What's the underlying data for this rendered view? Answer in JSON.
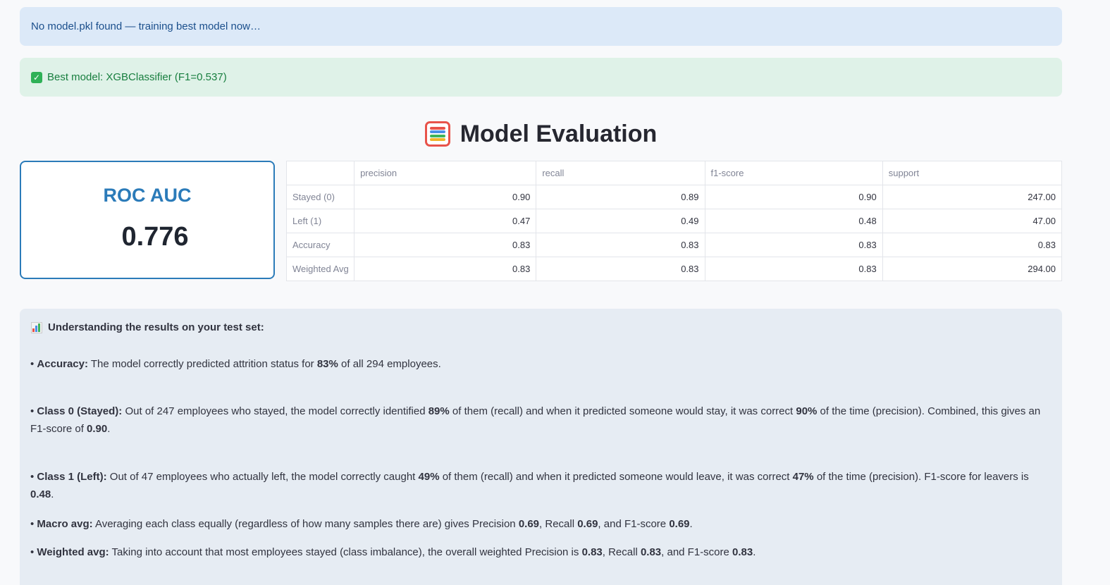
{
  "alerts": {
    "info": "No model.pkl found — training best model now…",
    "success": "Best model: XGBClassifier (F1=0.537)"
  },
  "title": "Model Evaluation",
  "roc": {
    "label": "ROC AUC",
    "value": "0.776"
  },
  "table": {
    "headers": [
      "",
      "precision",
      "recall",
      "f1-score",
      "support"
    ],
    "rows": [
      {
        "label": "Stayed (0)",
        "values": [
          "0.90",
          "0.89",
          "0.90",
          "247.00"
        ]
      },
      {
        "label": "Left (1)",
        "values": [
          "0.47",
          "0.49",
          "0.48",
          "47.00"
        ]
      },
      {
        "label": "Accuracy",
        "values": [
          "0.83",
          "0.83",
          "0.83",
          "0.83"
        ]
      },
      {
        "label": "Weighted Avg",
        "values": [
          "0.83",
          "0.83",
          "0.83",
          "294.00"
        ]
      }
    ]
  },
  "explanation": {
    "heading": "Understanding the results on your test set:",
    "accuracy": {
      "label": "Accuracy:",
      "t1": " The model correctly predicted attrition status for ",
      "b1": "83%",
      "t2": " of all 294 employees."
    },
    "class0": {
      "label": "Class 0 (Stayed):",
      "t1": " Out of 247 employees who stayed, the model correctly identified ",
      "b1": "89%",
      "t2": " of them (recall) and when it predicted someone would stay, it was correct ",
      "b2": "90%",
      "t3": " of the time (precision). Combined, this gives an F1-score of ",
      "b3": "0.90",
      "t4": "."
    },
    "class1": {
      "label": "Class 1 (Left):",
      "t1": " Out of 47 employees who actually left, the model correctly caught ",
      "b1": "49%",
      "t2": " of them (recall) and when it predicted someone would leave, it was correct ",
      "b2": "47%",
      "t3": " of the time (precision). F1-score for leavers is ",
      "b3": "0.48",
      "t4": "."
    },
    "macro": {
      "label": "Macro avg:",
      "t1": " Averaging each class equally (regardless of how many samples there are) gives Precision ",
      "b1": "0.69",
      "t2": ", Recall ",
      "b2": "0.69",
      "t3": ", and F1-score ",
      "b3": "0.69",
      "t4": "."
    },
    "weighted": {
      "label": "Weighted avg:",
      "t1": " Taking into account that most employees stayed (class imbalance), the overall weighted Precision is ",
      "b1": "0.83",
      "t2": ", Recall ",
      "b2": "0.83",
      "t3": ", and F1-score ",
      "b3": "0.83",
      "t4": "."
    }
  },
  "icons": [
    "check-icon",
    "abacus-icon",
    "bar-chart-icon"
  ],
  "colors": {
    "info_bg": "#dce9f8",
    "success_bg": "#dff2e8",
    "accent": "#2b7bb9",
    "note_bg": "#e6ecf3"
  }
}
